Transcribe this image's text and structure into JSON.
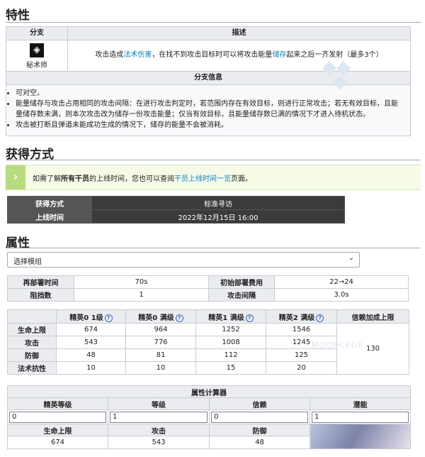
{
  "features": {
    "heading": "特性",
    "branch_header": "分支",
    "desc_header": "描述",
    "branch_name": "秘术师",
    "branch_icon": "arcanist-branch-icon",
    "desc_parts": [
      "攻击造成",
      "法术伤害",
      "，在找不到攻击目标时可以将攻击能量",
      "储存",
      "起来之后一齐发射（最多3个）"
    ],
    "branch_info_header": "分支信息",
    "notes": [
      "可对空。",
      "能量储存与攻击占用相同的攻击间隔：在进行攻击判定时，若范围内存在有效目标，则进行正常攻击；若无有效目标，且能量储存数未满，则本次攻击改为储存一份攻击能量；仅当有效目标，且能量储存数已满的情况下才进入待机状态。",
      "攻击被打断且弹道未能成功生成的情况下，储存的能量不会被消耗。"
    ]
  },
  "acquire": {
    "heading": "获得方式",
    "notice_parts": [
      "如需了解",
      "所有干员",
      "的上线时间，您也可以查阅",
      "干员上线时间一览",
      "页面。"
    ],
    "rows": [
      {
        "label": "获得方式",
        "value": "标准寻访"
      },
      {
        "label": "上线时间",
        "value": "2022年12月15日 16:00"
      }
    ]
  },
  "attributes": {
    "heading": "属性",
    "module_select": "选择模组",
    "basic": [
      [
        "再部署时间",
        "70s",
        "初始部署费用",
        "22→24"
      ],
      [
        "阻挡数",
        "1",
        "攻击间隔",
        "3.0s"
      ]
    ],
    "stat_columns": [
      "",
      "精英0 1级",
      "精英0 满级",
      "精英1 满级",
      "精英2 满级",
      "信赖加成上限"
    ],
    "stat_rows": [
      {
        "label": "生命上限",
        "values": [
          "674",
          "964",
          "1252",
          "1546"
        ]
      },
      {
        "label": "攻击",
        "values": [
          "543",
          "776",
          "1008",
          "1245"
        ]
      },
      {
        "label": "防御",
        "values": [
          "48",
          "81",
          "112",
          "125"
        ]
      },
      {
        "label": "法术抗性",
        "values": [
          "10",
          "10",
          "15",
          "20"
        ]
      }
    ],
    "trust_bonus": "130",
    "calculator": {
      "title": "属性计算器",
      "inputs": [
        {
          "label": "精英等级",
          "value": "0"
        },
        {
          "label": "等级",
          "value": "1"
        },
        {
          "label": "信赖",
          "value": "0"
        },
        {
          "label": "潜能",
          "value": "1"
        }
      ],
      "outputs": [
        {
          "label": "生命上限",
          "value": "674"
        },
        {
          "label": "攻击",
          "value": "543"
        },
        {
          "label": "防御",
          "value": "48"
        }
      ]
    }
  },
  "watermark": "MOONCEDE"
}
